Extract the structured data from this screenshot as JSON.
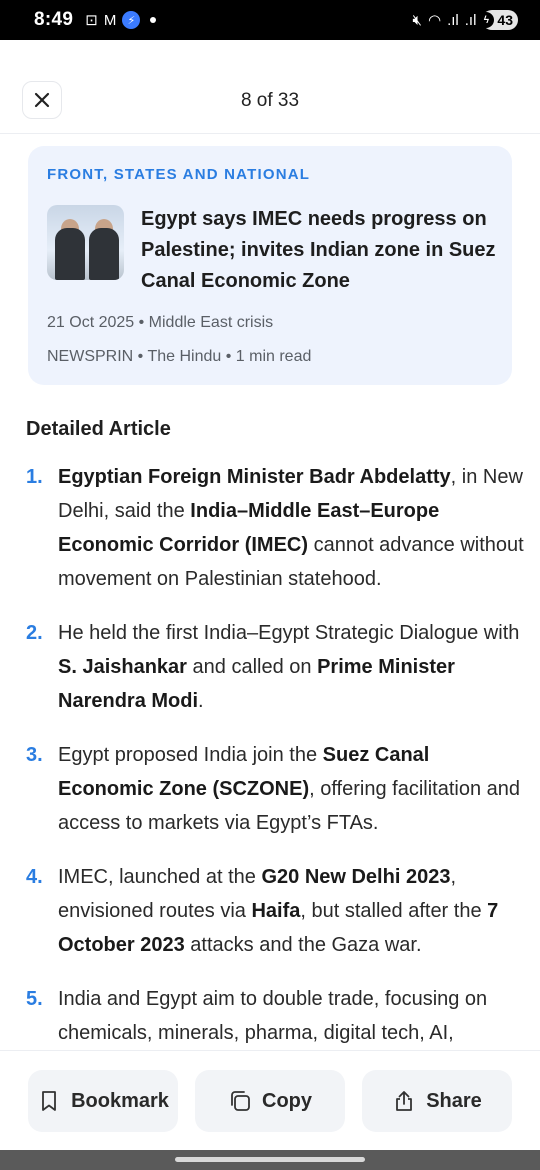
{
  "status_bar": {
    "time": "8:49",
    "battery": "43"
  },
  "header": {
    "counter": "8 of 33"
  },
  "card": {
    "category": "FRONT, STATES AND NATIONAL",
    "headline": "Egypt says IMEC needs progress on Palestine; invites Indian zone in Suez Canal Economic Zone",
    "date": "21 Oct 2025",
    "topic": "Middle East crisis",
    "source_code": "NEWSPRIN",
    "publisher": "The Hindu",
    "read_time": "1 min read",
    "meta_separator": " • "
  },
  "article": {
    "section_title": "Detailed Article",
    "points": [
      {
        "num": "1.",
        "parts": [
          {
            "t": "Egyptian Foreign Minister Badr Abdelatty",
            "b": true
          },
          {
            "t": ", in New Delhi, said the ",
            "b": false
          },
          {
            "t": "India–Middle East–Europe Economic Corridor (IMEC)",
            "b": true
          },
          {
            "t": " cannot advance without movement on Palestinian statehood.",
            "b": false
          }
        ]
      },
      {
        "num": "2.",
        "parts": [
          {
            "t": "He held the first India–Egypt Strategic Dialogue with ",
            "b": false
          },
          {
            "t": "S. Jaishankar",
            "b": true
          },
          {
            "t": " and called on ",
            "b": false
          },
          {
            "t": "Prime Minister Narendra Modi",
            "b": true
          },
          {
            "t": ".",
            "b": false
          }
        ]
      },
      {
        "num": "3.",
        "parts": [
          {
            "t": "Egypt proposed India join the ",
            "b": false
          },
          {
            "t": "Suez Canal Economic Zone (SCZONE)",
            "b": true
          },
          {
            "t": ", offering facilitation and access to markets via Egypt’s FTAs.",
            "b": false
          }
        ]
      },
      {
        "num": "4.",
        "parts": [
          {
            "t": "IMEC, launched at the ",
            "b": false
          },
          {
            "t": "G20 New Delhi 2023",
            "b": true
          },
          {
            "t": ", envisioned routes via ",
            "b": false
          },
          {
            "t": "Haifa",
            "b": true
          },
          {
            "t": ", but stalled after the ",
            "b": false
          },
          {
            "t": "7 October 2023",
            "b": true
          },
          {
            "t": " attacks and the Gaza war.",
            "b": false
          }
        ]
      },
      {
        "num": "5.",
        "parts": [
          {
            "t": "India and Egypt aim to double trade, focusing on chemicals, minerals, pharma, digital tech, AI,",
            "b": false
          }
        ]
      }
    ]
  },
  "actions": {
    "bookmark_label": "Bookmark",
    "copy_label": "Copy",
    "share_label": "Share"
  },
  "colors": {
    "accent": "#2a7de1",
    "card_bg": "#eef3fd",
    "button_bg": "#f2f4f7"
  }
}
